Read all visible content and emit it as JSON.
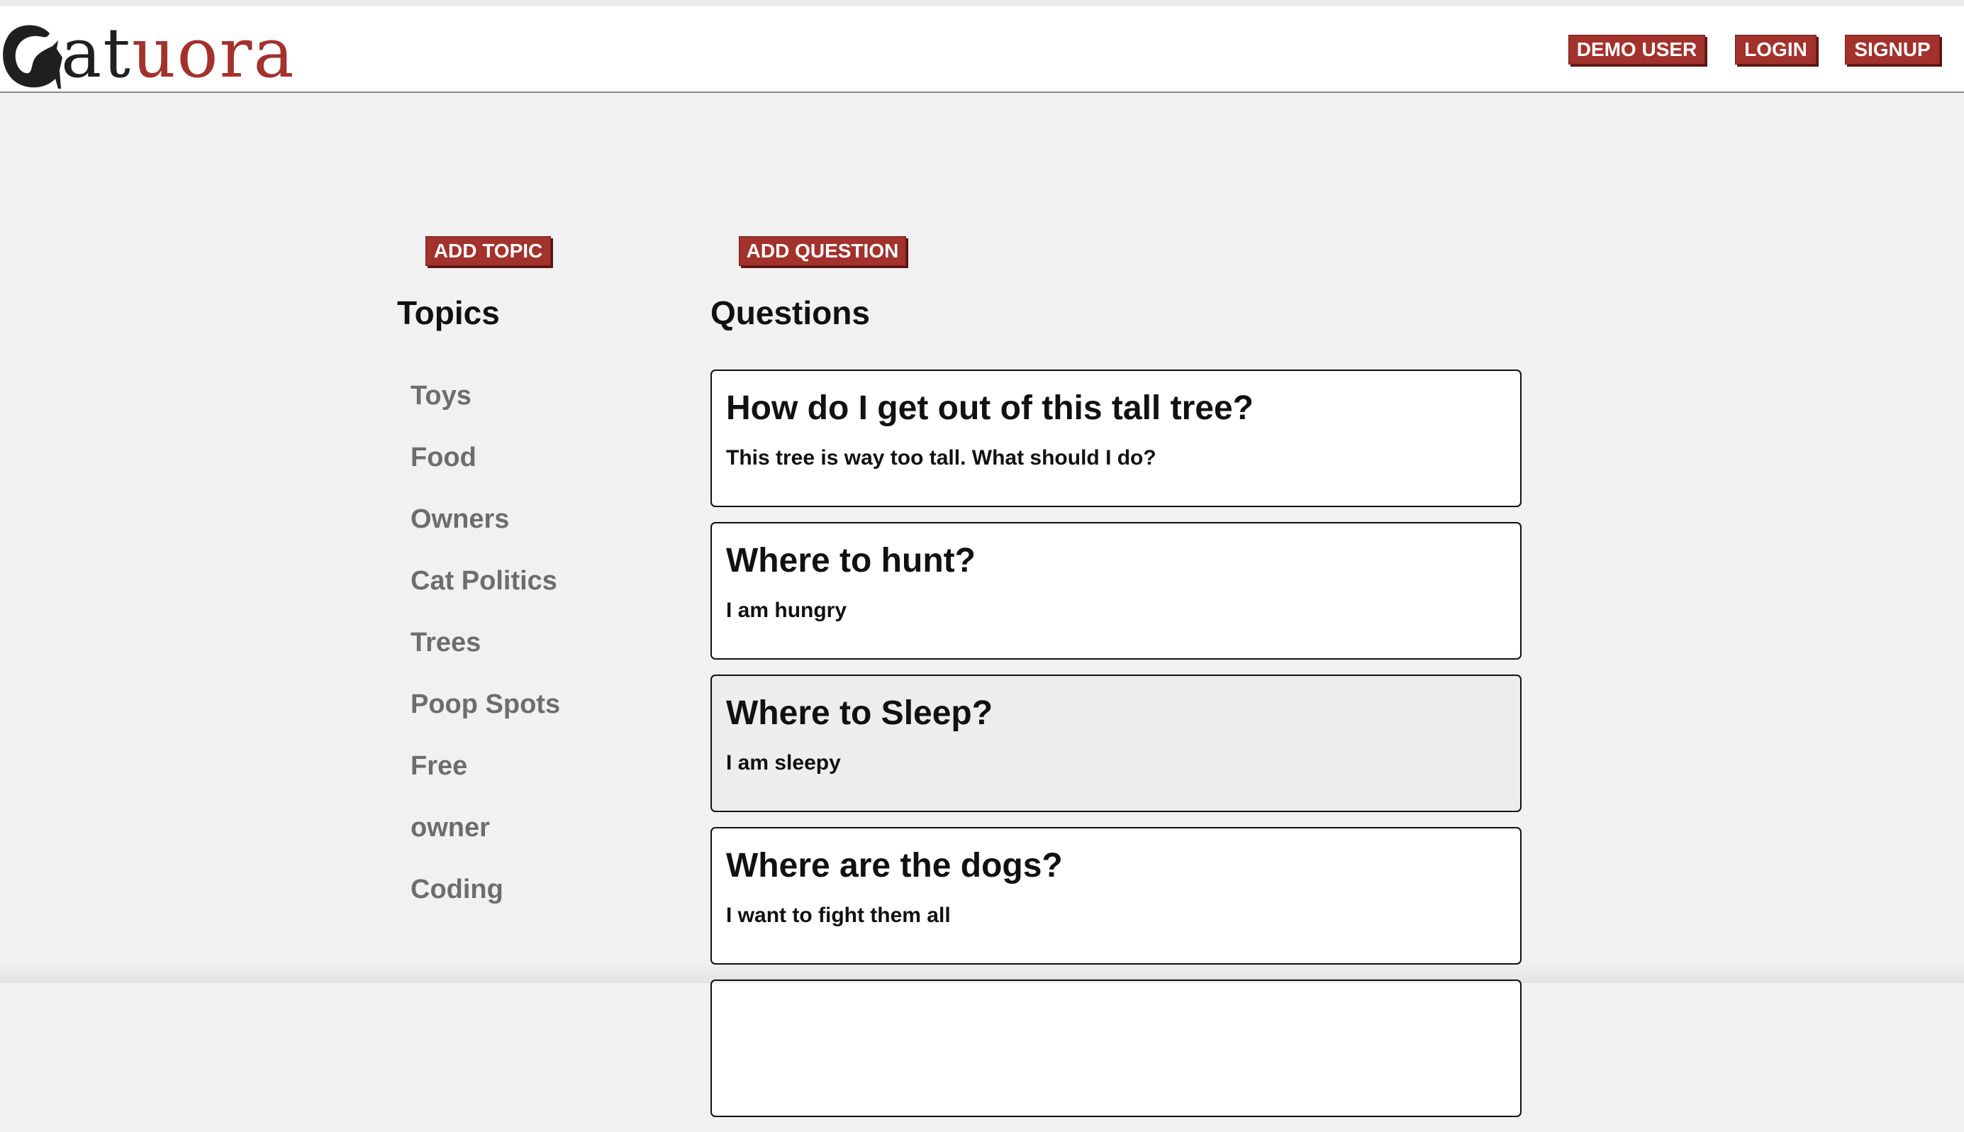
{
  "brand": {
    "logo_text_dark": "at",
    "logo_text_red": "uora",
    "logo_icon": "cat-silhouette-icon",
    "colors": {
      "brand_red": "#a3312c",
      "dark": "#1f1f1f"
    }
  },
  "nav": {
    "demo_label": "DEMO USER",
    "login_label": "LOGIN",
    "signup_label": "SIGNUP"
  },
  "topics": {
    "add_label": "ADD TOPIC",
    "heading": "Topics",
    "items": [
      "Toys",
      "Food",
      "Owners",
      "Cat Politics",
      "Trees",
      "Poop Spots",
      "Free",
      "owner",
      "Coding"
    ]
  },
  "questions": {
    "add_label": "ADD QUESTION",
    "heading": "Questions",
    "items": [
      {
        "title": "How do I get out of this tall tree?",
        "body": "This tree is way too tall. What should I do?"
      },
      {
        "title": "Where to hunt?",
        "body": "I am hungry"
      },
      {
        "title": "Where to Sleep?",
        "body": "I am sleepy"
      },
      {
        "title": "Where are the dogs?",
        "body": "I want to fight them all"
      }
    ]
  }
}
